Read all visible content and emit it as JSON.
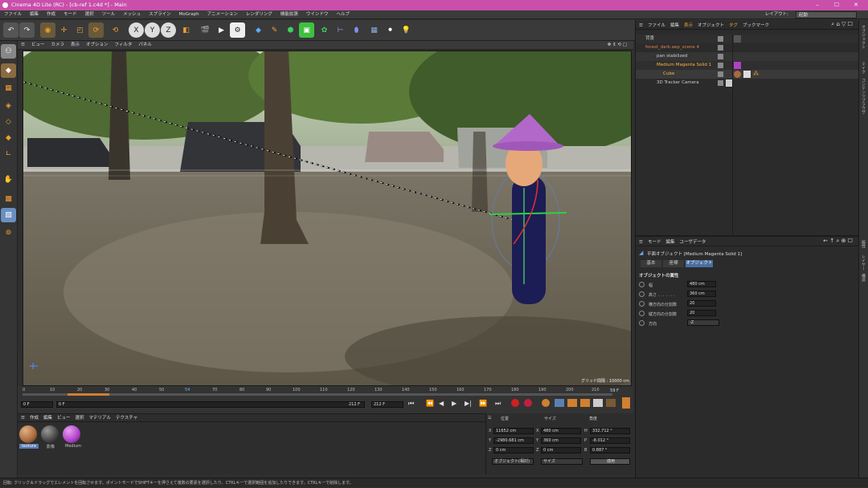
{
  "window": {
    "title": "Cinema 4D Lite (RC) - [cb-ref 1.c4d *] - Main",
    "minimize": "–",
    "maximize": "☐",
    "close": "✕"
  },
  "menu": [
    "ファイル",
    "編集",
    "作成",
    "モード",
    "選択",
    "ツール",
    "メッシュ",
    "スプライン",
    "MoGraph",
    "アニメーション",
    "レンダリング",
    "機能拡張",
    "ウインドウ",
    "ヘルプ"
  ],
  "layout": {
    "label": "レイアウト:",
    "value": "起動"
  },
  "viewport_menu": [
    "ビュー",
    "カメラ",
    "表示",
    "オプション",
    "フィルタ",
    "パネル"
  ],
  "viewport": {
    "grid_text": "グリッド間隔 : 10000 cm",
    "icons": "✥ ⇕ ⟲ ▢"
  },
  "timeline": {
    "ticks": [
      "0",
      "10",
      "20",
      "30",
      "40",
      "50",
      "54",
      "70",
      "80",
      "90",
      "100",
      "110",
      "120",
      "130",
      "140",
      "150",
      "160",
      "170",
      "180",
      "190",
      "200",
      "210"
    ],
    "end_frame": "59 F",
    "current_frame": "0 F",
    "start_field": "0 F",
    "end_field": "212 F",
    "end_field2": "212 F"
  },
  "materials": {
    "menu": [
      "作成",
      "編集",
      "ビュー",
      "選択",
      "マテリアル",
      "テクスチャ"
    ],
    "items": [
      {
        "label": "texture",
        "color": "#a86a3e"
      },
      {
        "label": "影像",
        "color": "#444"
      },
      {
        "label": "Medium",
        "color": "#b040c8"
      }
    ]
  },
  "coords": {
    "headers": [
      "位置",
      "サイズ",
      "角度"
    ],
    "rows": [
      {
        "axis": "X",
        "pos": "11652 cm",
        "size_axis": "X",
        "size": "480 cm",
        "rot_axis": "H",
        "rot": "332.712 °"
      },
      {
        "axis": "Y",
        "pos": "-2980.681 cm",
        "size_axis": "Y",
        "size": "360 cm",
        "rot_axis": "P",
        "rot": "-8.012 °"
      },
      {
        "axis": "Z",
        "pos": "0 cm",
        "size_axis": "Z",
        "size": "0 cm",
        "rot_axis": "B",
        "rot": "0.887 °"
      }
    ],
    "mode": "オブジェクト(相対)",
    "size_mode": "サイズ",
    "apply": "適用"
  },
  "status": "回転: クリック＆ドラッグでエレメントを回転させます。ポイントモードでSHIFTキーを押さえて複数の要素を選択したり、CTRLキーで選択範囲を追加したりできます。CTRLキーで削除します。",
  "object_manager": {
    "menu": [
      "ファイル",
      "編集",
      "表示",
      "オブジェクト",
      "タグ",
      "ブックマーク"
    ],
    "objects": [
      {
        "name": "背景",
        "indent": 0,
        "color": "#ccc"
      },
      {
        "name": "forest_dark.aep_scene 4",
        "indent": 0,
        "color": "#e08050"
      },
      {
        "name": "pan stabilized",
        "indent": 1,
        "color": "#ccc"
      },
      {
        "name": "Medium Magenta Solid 1",
        "indent": 1,
        "color": "#ffb347"
      },
      {
        "name": "Cube",
        "indent": 2,
        "color": "#ffb347"
      },
      {
        "name": "3D Tracker Camera",
        "indent": 1,
        "color": "#ccc"
      }
    ]
  },
  "attributes": {
    "menu": [
      "モード",
      "編集",
      "ユーザデータ"
    ],
    "title": "平面オブジェクト [Medium Magenta Solid 1]",
    "tabs": [
      "基本",
      "座標",
      "オブジェクト"
    ],
    "section": "オブジェクトの属性",
    "props": [
      {
        "label": "幅",
        "value": "480 cm"
      },
      {
        "label": "高さ . . . . . . .",
        "value": "360 cm"
      },
      {
        "label": "横方向の分割数",
        "value": "20"
      },
      {
        "label": "縦方向の分割数",
        "value": "20"
      },
      {
        "label": "方向",
        "value": "-Z"
      }
    ]
  },
  "sidetabs": [
    "オブジェクト",
    "テイク",
    "コンテンツブラウザ",
    "属性",
    "レイヤー",
    "構造"
  ]
}
